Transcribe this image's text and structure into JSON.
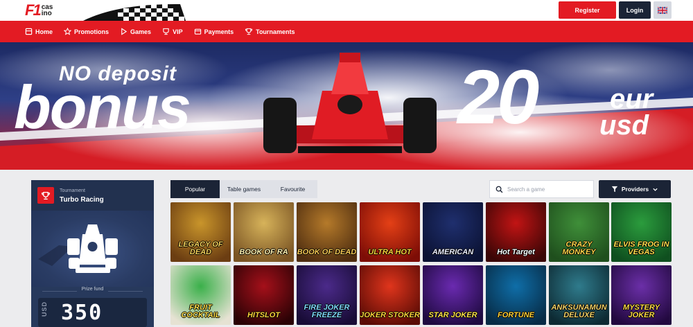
{
  "header": {
    "logo_mark": "F1",
    "logo_line1": "cas",
    "logo_line2": "ino",
    "register_label": "Register",
    "login_label": "Login",
    "language_icon": "uk-flag-icon"
  },
  "nav": {
    "items": [
      {
        "label": "Home",
        "icon": "home-icon"
      },
      {
        "label": "Promotions",
        "icon": "star-icon"
      },
      {
        "label": "Games",
        "icon": "play-icon"
      },
      {
        "label": "VIP",
        "icon": "vip-icon"
      },
      {
        "label": "Payments",
        "icon": "wallet-icon"
      },
      {
        "label": "Tournaments",
        "icon": "trophy-icon"
      }
    ]
  },
  "banner": {
    "line1": "NO deposit",
    "line2": "bonus",
    "amount": "20",
    "cur1": "eur",
    "cur2": "usd"
  },
  "tournament": {
    "label": "Tournament",
    "name": "Turbo Racing",
    "prize_label": "Prize fund",
    "prize_currency": "USD",
    "prize_value": "350"
  },
  "tabs": {
    "items": [
      "Popular",
      "Table games",
      "Favourite"
    ],
    "active": "Popular"
  },
  "search": {
    "placeholder": "Search a game"
  },
  "providers_label": "Providers",
  "games": {
    "row1": [
      {
        "title": "LEGACY OF DEAD",
        "bg1": "#c9952b",
        "bg2": "#6b3d12",
        "fg": "#f5d15a"
      },
      {
        "title": "BOOK OF RA",
        "bg1": "#d7b35a",
        "bg2": "#7a5424",
        "fg": "#fff1b0"
      },
      {
        "title": "BOOK OF DEAD",
        "bg1": "#b57a2a",
        "bg2": "#4e2d10",
        "fg": "#f7c954"
      },
      {
        "title": "ULTRA HOT",
        "bg1": "#e44016",
        "bg2": "#7d0d06",
        "fg": "#ffd23a"
      },
      {
        "title": "AMERICAN",
        "bg1": "#1f2f6e",
        "bg2": "#0b1233",
        "fg": "#e8ecff"
      },
      {
        "title": "Hot Target",
        "bg1": "#c21414",
        "bg2": "#3a0606",
        "fg": "#ffffff"
      },
      {
        "title": "CRAZY MONKEY",
        "bg1": "#3f8f39",
        "bg2": "#1f4f1d",
        "fg": "#ffd84a"
      },
      {
        "title": "ELVIS FROG IN VEGAS",
        "bg1": "#2b9c3d",
        "bg2": "#0f4f1f",
        "fg": "#ffe14d"
      }
    ],
    "row2": [
      {
        "title": "FRUIT COCKTAIL",
        "bg1": "#3ab04a",
        "bg2": "#e6e2d3",
        "fg": "#ffe14d"
      },
      {
        "title": "HITSLOT",
        "bg1": "#a5101a",
        "bg2": "#2a0205",
        "fg": "#ffd23a"
      },
      {
        "title": "FIRE JOKER FREEZE",
        "bg1": "#4b2a8a",
        "bg2": "#180c36",
        "fg": "#7fd8ff"
      },
      {
        "title": "JOKER STOKER",
        "bg1": "#e0351c",
        "bg2": "#5a0b05",
        "fg": "#ffd23a"
      },
      {
        "title": "STAR JOKER",
        "bg1": "#6a2ab0",
        "bg2": "#1e0a40",
        "fg": "#ffe14d"
      },
      {
        "title": "FORTUNE",
        "bg1": "#0f6ea8",
        "bg2": "#072b45",
        "fg": "#ffd23a"
      },
      {
        "title": "ANKSUNAMUN DELUXE",
        "bg1": "#2f7b8c",
        "bg2": "#0d2a33",
        "fg": "#f1d36a"
      },
      {
        "title": "MYSTERY JOKER",
        "bg1": "#6b2fa8",
        "bg2": "#22093f",
        "fg": "#ffd84a"
      }
    ]
  },
  "colors": {
    "brand_red": "#e31b23",
    "navy": "#1b2436"
  }
}
